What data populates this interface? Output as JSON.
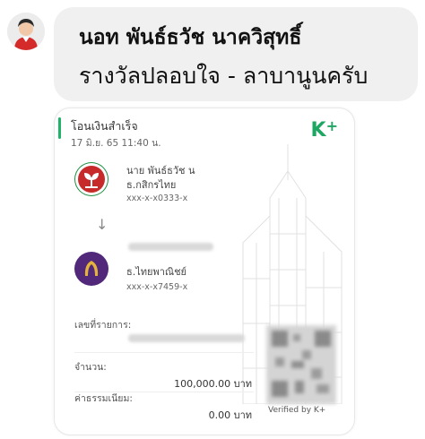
{
  "chat": {
    "sender_name": "นอท พันธ์ธวัช นาควิสุทธิ์",
    "message": "รางวัลปลอบใจ - ลาบานูนครับ"
  },
  "slip": {
    "title": "โอนเงินสำเร็จ",
    "datetime": "17 มิ.ย. 65  11:40 น.",
    "brand": "K",
    "brand_plus": "+",
    "sender": {
      "name": "นาย พันธ์ธวัช น",
      "bank": "ธ.กสิกรไทย",
      "account": "xxx-x-x0333-x"
    },
    "receiver": {
      "bank": "ธ.ไทยพาณิชย์",
      "account": "xxx-x-x7459-x"
    },
    "arrow": "↓",
    "ref_label": "เลขที่รายการ:",
    "amount_label": "จำนวน:",
    "amount_value": "100,000.00 บาท",
    "fee_label": "ค่าธรรมเนียม:",
    "fee_value": "0.00 บาท",
    "verified": "Verified by K+"
  },
  "colors": {
    "kbank_green": "#1a8f3f",
    "kplus_green": "#1ea663",
    "scb_purple": "#51287a",
    "bubble_bg": "#f0f0f0"
  },
  "icons": [
    "avatar-icon",
    "kbank-logo-icon",
    "scb-logo-icon",
    "qr-code-icon",
    "building-watermark-icon"
  ]
}
